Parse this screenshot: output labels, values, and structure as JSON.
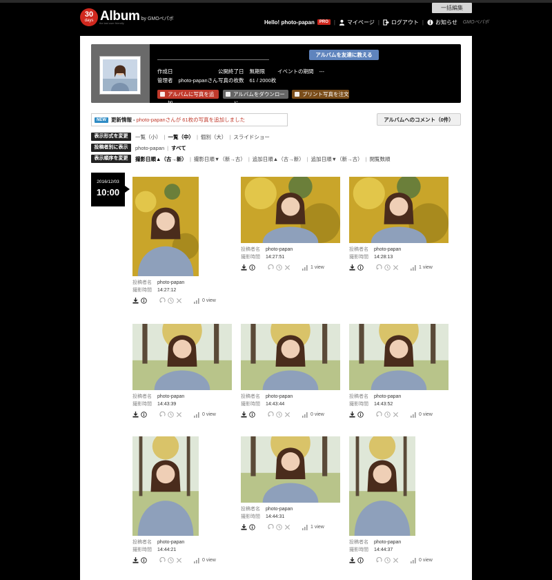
{
  "header": {
    "bulk_edit": "一括編集",
    "logo_number": "30",
    "logo_days": "days",
    "logo_name": "Album",
    "logo_by": "by GMOペパボ",
    "logo_tagline": "the last user friendly",
    "hello": "Hello! photo-papan",
    "pro_badge": "PRO",
    "mypage": "マイページ",
    "logout": "ログアウト",
    "notice": "お知らせ",
    "gmo": "GMOペパボ"
  },
  "album": {
    "share_button": "アルバムを友達に教える",
    "created_label": "作成日",
    "created_value": "",
    "close_label": "公開終了日",
    "close_value": "無期限",
    "event_label": "イベントの期間",
    "event_value": "---",
    "admin_label": "管理者",
    "admin_value": "photo-papanさん",
    "count_label": "写真の枚数",
    "count_value": "61 / 2000枚",
    "add_photo": "アルバムに写真を追加",
    "download": "アルバムをダウンロード",
    "print": "プリント写真を注文"
  },
  "news": {
    "badge": "NEW",
    "label": "更新情報 -",
    "message": "photo-papanさんが 61枚の写真を追加しました"
  },
  "comment_button": "アルバムへのコメント（0件）",
  "filters": {
    "display": {
      "label": "表示形式を変更",
      "options": [
        "一覧（小）",
        "一覧（中）",
        "個別（大）",
        "スライドショー"
      ],
      "selected": 1
    },
    "poster": {
      "label": "投稿者別に表示",
      "options": [
        "photo-papan",
        "すべて"
      ],
      "selected": 1
    },
    "order": {
      "label": "表示順序を変更",
      "options": [
        "撮影日順▲（古→新）",
        "撮影日順▼（新→古）",
        "追加日順▲（古→新）",
        "追加日順▼（新→古）",
        "閲覧数順"
      ],
      "selected": 0
    }
  },
  "date_group": {
    "date": "2016/12/03",
    "time": "10:00"
  },
  "photo_meta": {
    "poster_label": "投稿者名",
    "time_label": "撮影時間"
  },
  "photos": [
    {
      "poster": "photo-papan",
      "time": "14:27:12",
      "views": "0 view",
      "scene": "ginkgo",
      "orient": "portrait"
    },
    {
      "poster": "photo-papan",
      "time": "14:27:51",
      "views": "1 view",
      "scene": "ginkgo",
      "orient": "landscape"
    },
    {
      "poster": "photo-papan",
      "time": "14:28:13",
      "views": "1 view",
      "scene": "ginkgo",
      "orient": "landscape"
    },
    {
      "poster": "photo-papan",
      "time": "14:43:39",
      "views": "0 view",
      "scene": "park",
      "orient": "landscape"
    },
    {
      "poster": "photo-papan",
      "time": "14:43:44",
      "views": "0 view",
      "scene": "park",
      "orient": "landscape"
    },
    {
      "poster": "photo-papan",
      "time": "14:43:52",
      "views": "0 view",
      "scene": "park",
      "orient": "landscape"
    },
    {
      "poster": "photo-papan",
      "time": "14:44:21",
      "views": "0 view",
      "scene": "park",
      "orient": "portrait"
    },
    {
      "poster": "photo-papan",
      "time": "14:44:31",
      "views": "1 view",
      "scene": "park",
      "orient": "landscape"
    },
    {
      "poster": "photo-papan",
      "time": "14:44:37",
      "views": "0 view",
      "scene": "park",
      "orient": "portrait"
    }
  ],
  "colors": {
    "accent_red": "#d0281e",
    "share_blue": "#5f84bd",
    "new_blue": "#2f8cc5"
  }
}
